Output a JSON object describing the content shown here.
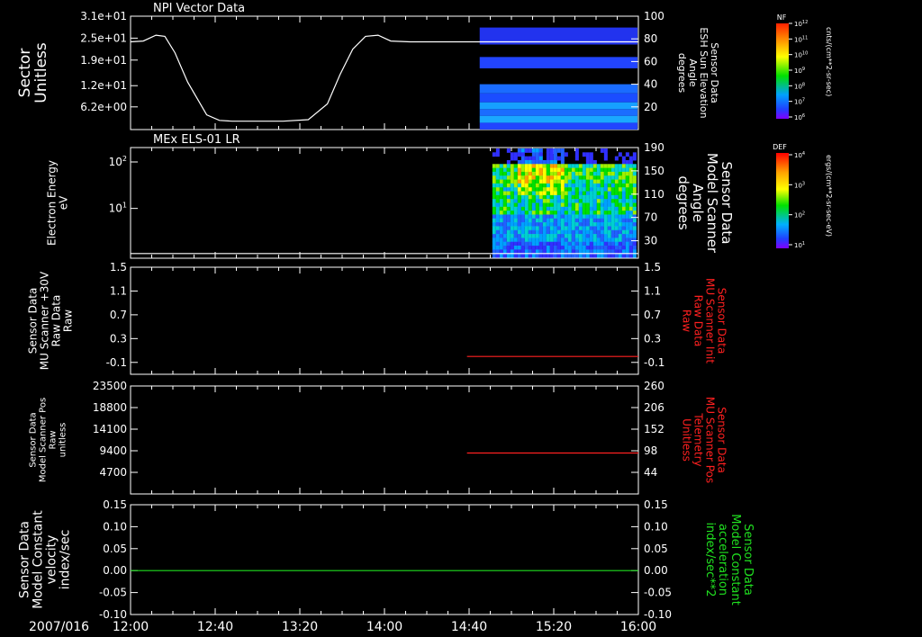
{
  "date_label": "2007/016",
  "time_ticks": [
    "12:00",
    "12:40",
    "13:20",
    "14:00",
    "14:40",
    "15:20",
    "16:00"
  ],
  "colors": {
    "background": "#000000",
    "axes": "#ffffff",
    "red_trace": "#ff2020",
    "green_trace": "#20e020"
  },
  "colorbars": [
    {
      "title": "NF",
      "unit": "cnts/(cm**2-sr-sec)",
      "ticks": [
        "10^12",
        "10^11",
        "10^10",
        "10^9",
        "10^8",
        "10^7",
        "10^6"
      ]
    },
    {
      "title": "DEF",
      "unit": "ergs/(cm**2-sr-sec-eV)",
      "ticks": [
        "10^4",
        "10^3",
        "10^2",
        "10^1"
      ]
    }
  ],
  "chart_data": [
    {
      "type": "line",
      "title": "NPI Vector Data",
      "ylabel": [
        "Sector",
        "Unitless"
      ],
      "y_ticks": [
        "3.1e+01",
        "2.5e+01",
        "1.9e+01",
        "1.2e+01",
        "6.2e+00"
      ],
      "y_tick_values": [
        31,
        25,
        19,
        12,
        6.2
      ],
      "ylim": [
        0,
        31
      ],
      "right_ylabel": [
        "Sensor Data",
        "ESH Sun Elevation",
        "Angle",
        "degrees"
      ],
      "right_ticks": [
        "100",
        "80",
        "60",
        "40",
        "20"
      ],
      "right_ylim": [
        0,
        100
      ],
      "series": [
        {
          "values_hours": [
            0,
            0.1,
            0.2,
            0.27,
            0.35,
            0.45,
            0.6,
            0.7,
            0.8,
            1.2,
            1.4,
            1.55,
            1.65,
            1.75,
            1.85,
            1.95,
            2.05,
            2.2,
            4
          ],
          "values": [
            24,
            24.2,
            25.8,
            25.5,
            21,
            13,
            4,
            2.5,
            2.3,
            2.3,
            2.7,
            7,
            15,
            22,
            25.5,
            25.8,
            24.2,
            24,
            24
          ]
        }
      ],
      "spectrogram_start_hour": 2.75
    },
    {
      "type": "heatmap",
      "title": "MEx ELS-01 LR",
      "ylabel": [
        "Electron Energy",
        "eV"
      ],
      "y_ticks": [
        "10^2",
        "10^1"
      ],
      "y_scale": "log",
      "right_ylabel": [
        "Sensor Data",
        "Model Scanner",
        "Angle",
        "degrees"
      ],
      "right_ticks": [
        "190",
        "150",
        "110",
        "70",
        "30"
      ],
      "right_ylim": [
        0,
        190
      ],
      "baseline_angle": 8,
      "spectrogram_start_hour": 2.85
    },
    {
      "type": "line",
      "ylabel": [
        "Sensor Data",
        "MU Scanner +30V",
        "Raw Data",
        "Raw"
      ],
      "y_ticks": [
        "1.5",
        "1.1",
        "0.7",
        "0.3",
        "-0.1"
      ],
      "ylim": [
        -0.3,
        1.5
      ],
      "right_ylabel": [
        "Sensor Data",
        "MU Scanner Init",
        "Raw Data",
        "Raw"
      ],
      "right_ticks": [
        "1.5",
        "1.1",
        "0.7",
        "0.3",
        "-0.1"
      ],
      "series": [
        {
          "start_hour": 2.65,
          "end_hour": 4,
          "value": 0
        }
      ]
    },
    {
      "type": "line",
      "ylabel": [
        "Sensor Data",
        "Model Scanner Pos",
        "Raw",
        "unitless"
      ],
      "y_ticks": [
        "23500",
        "18800",
        "14100",
        "9400",
        "4700"
      ],
      "ylim": [
        0,
        23500
      ],
      "right_ylabel": [
        "Sensor Data",
        "MU Scanner Pos",
        "Telemetry",
        "Unitless"
      ],
      "right_ticks": [
        "260",
        "206",
        "152",
        "98",
        "44"
      ],
      "right_ylim": [
        0,
        260
      ],
      "series": [
        {
          "start_hour": 2.65,
          "end_hour": 4,
          "value": 8100
        }
      ]
    },
    {
      "type": "line",
      "ylabel": [
        "Sensor Data",
        "Model Constant",
        "velocity",
        "index/sec"
      ],
      "y_ticks": [
        "0.15",
        "0.10",
        "0.05",
        "0.00",
        "-0.05",
        "-0.10"
      ],
      "ylim": [
        -0.1,
        0.15
      ],
      "right_ylabel": [
        "Sensor Data",
        "Model Constant",
        "acceleration",
        "index/sec**2"
      ],
      "right_ticks": [
        "0.15",
        "0.10",
        "0.05",
        "0.00",
        "-0.05",
        "-0.10"
      ],
      "series": [
        {
          "start_hour": 0,
          "end_hour": 4,
          "value": 0
        }
      ]
    }
  ]
}
